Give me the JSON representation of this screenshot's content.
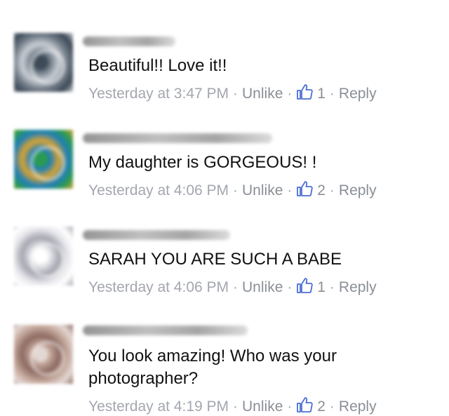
{
  "comments": [
    {
      "text": "Beautiful!! Love it!!",
      "timestamp": "Yesterday at 3:47 PM",
      "unlike": "Unlike",
      "likes": "1",
      "reply": "Reply",
      "avatar_colors": [
        "#6f7a86",
        "#c9ced4",
        "#3d4a57"
      ]
    },
    {
      "text": "My daughter is GORGEOUS! !",
      "timestamp": "Yesterday at 4:06 PM",
      "unlike": "Unlike",
      "likes": "2",
      "reply": "Reply",
      "avatar_colors": [
        "#1f7fb8",
        "#d8a233",
        "#2a9a53"
      ]
    },
    {
      "text": "SARAH YOU ARE SUCH A BABE",
      "timestamp": "Yesterday at 4:06 PM",
      "unlike": "Unlike",
      "likes": "1",
      "reply": "Reply",
      "avatar_colors": [
        "#e8e8ec",
        "#a5a7b0",
        "#ffffff"
      ]
    },
    {
      "text": "You look amazing! Who was your photographer?",
      "timestamp": "Yesterday at 4:19 PM",
      "unlike": "Unlike",
      "likes": "2",
      "reply": "Reply",
      "avatar_colors": [
        "#c4a79b",
        "#8d6b62",
        "#e4d8d4"
      ]
    }
  ],
  "ui": {
    "meta_color": "#a3a7ae",
    "link_color": "#8a8f96",
    "like_icon": "thumbs-up-icon",
    "like_icon_color": "#4a6fd8"
  }
}
